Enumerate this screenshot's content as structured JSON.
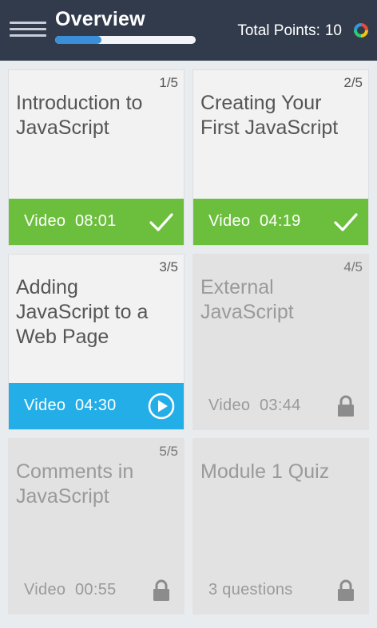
{
  "header": {
    "title": "Overview",
    "progress_fraction": 0.33,
    "points_label": "Total Points:",
    "points_value": "10",
    "menu_icon": "hamburger-menu-icon",
    "logo_icon": "colorful-ring-logo"
  },
  "colors": {
    "header_bg": "#323b4c",
    "completed": "#6cbf3d",
    "current": "#24aee8",
    "locked_bg": "#e2e2e2",
    "progress": "#3a8fd8"
  },
  "cards": [
    {
      "number": "1/5",
      "title": "Introduction to JavaScript",
      "footer": "Video  08:01",
      "status": "completed",
      "icon": "checkmark-icon"
    },
    {
      "number": "2/5",
      "title": "Creating Your First JavaScript",
      "footer": "Video  04:19",
      "status": "completed",
      "icon": "checkmark-icon"
    },
    {
      "number": "3/5",
      "title": "Adding JavaScript to a Web Page",
      "footer": "Video  04:30",
      "status": "current",
      "icon": "play-circle-icon"
    },
    {
      "number": "4/5",
      "title": "External JavaScript",
      "footer": "Video  03:44",
      "status": "locked",
      "icon": "lock-icon"
    },
    {
      "number": "5/5",
      "title": "Comments in JavaScript",
      "footer": "Video  00:55",
      "status": "locked",
      "icon": "lock-icon"
    },
    {
      "number": "",
      "title": "Module 1 Quiz",
      "footer": "3 questions",
      "status": "locked",
      "icon": "lock-icon"
    }
  ]
}
